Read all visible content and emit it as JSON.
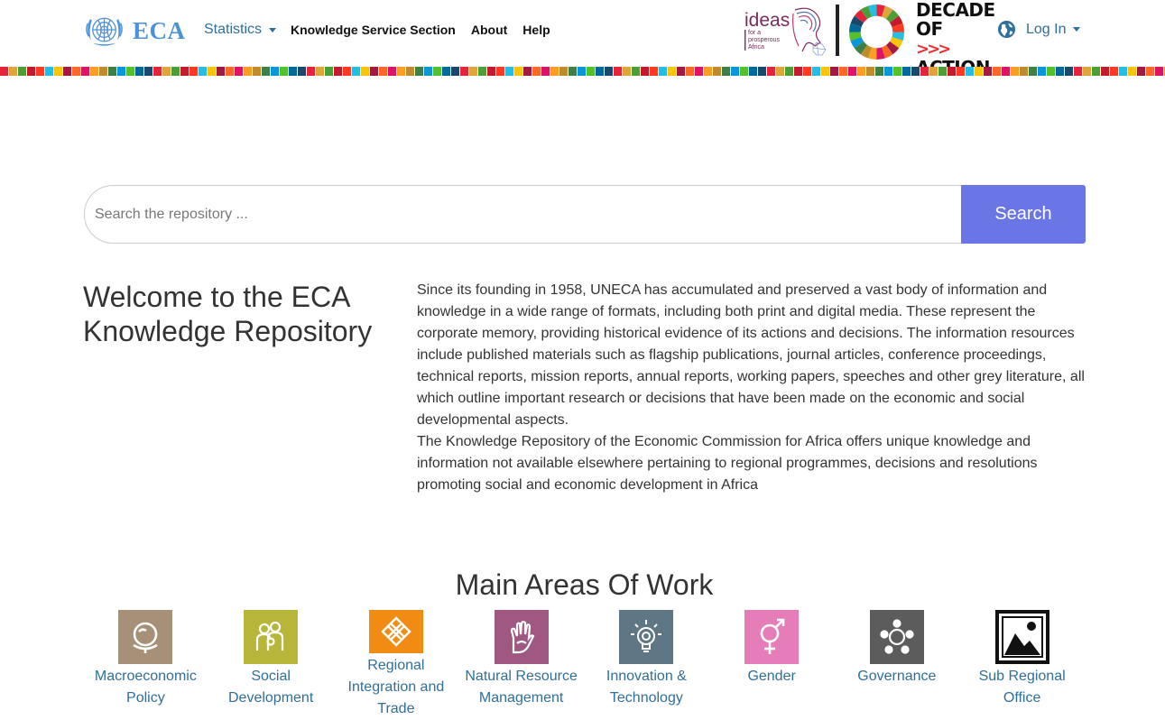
{
  "header": {
    "logo_text": "ECA",
    "nav": {
      "statistics_label": "Statistics",
      "knowledge_label": "Knowledge Service Section",
      "about_label": "About",
      "help_label": "Help"
    },
    "ideas_logo": {
      "word": "ideas",
      "tagline_1": "for a",
      "tagline_2": "prosperous",
      "tagline_3": "Africa"
    },
    "decade": {
      "line1": "DECADE",
      "line2": "OF",
      "arrows": ">>>",
      "line3": "ACTION"
    },
    "login_label": "Log In"
  },
  "search": {
    "placeholder": "Search the repository ...",
    "value": "",
    "button_label": "Search"
  },
  "welcome": {
    "title": "Welcome to the ECA Knowledge Repository",
    "paragraph_1": "Since its founding in 1958, UNECA has accumulated and preserved a vast body of information and knowledge in a wide range of formats, including both print and digital media. These represent the corporate memory, providing historical evidence of its actions and decisions. The information resources include published materials such as flagship publications, journal articles, conference proceedings, technical reports, mission reports, annual reports, working papers, speeches and other grey literature, all which outline important research or decisions that have been made on the economic and social developmental aspects.",
    "paragraph_2": "The Knowledge Repository of the Economic Commission for Africa offers unique knowledge and information not available elsewhere pertaining to regional programmes, decisions and resolutions promoting social and economic development in Africa"
  },
  "areas": {
    "title": "Main Areas Of Work",
    "items": [
      {
        "label": "Macroeconomic Policy",
        "color": "#a69078",
        "icon": "globe-stand-icon"
      },
      {
        "label": "Social Development",
        "color": "#b7b63b",
        "icon": "people-icon"
      },
      {
        "label": "Regional Integration and Trade",
        "color": "#f28b13",
        "icon": "knot-icon"
      },
      {
        "label": "Natural Resource Management",
        "color": "#9e5882",
        "icon": "hand-icon"
      },
      {
        "label": "Innovation & Technology",
        "color": "#5f7685",
        "icon": "lightbulb-icon"
      },
      {
        "label": "Gender",
        "color": "#e57eb8",
        "icon": "gender-icon"
      },
      {
        "label": "Governance",
        "color": "#5c5c5c",
        "icon": "network-icon"
      },
      {
        "label": "Sub Regional Office",
        "color": "#111111",
        "icon": "image-icon"
      }
    ]
  },
  "colors": {
    "accent_link": "#2f6f99",
    "search_button": "#6b76e6",
    "logo_blue": "#4b92db"
  }
}
